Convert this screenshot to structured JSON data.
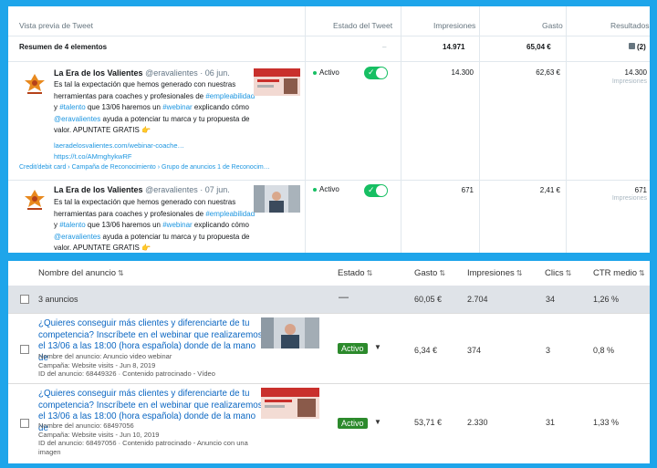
{
  "twitter": {
    "headers": {
      "preview": "Vista previa de Tweet",
      "status": "Estado del Tweet",
      "impressions": "Impresiones",
      "spend": "Gasto",
      "results": "Resultados"
    },
    "summary": {
      "label": "Resumen de 4 elementos",
      "status": "–",
      "impressions": "14.971",
      "spend": "65,04 €",
      "results": "(2)"
    },
    "rows": [
      {
        "name": "La Era de los Valientes",
        "handle": "@eravalientes · 06 jun.",
        "text_a": "Es tal la expectación que hemos generado con nuestras herramientas para coaches y profesionales de ",
        "tag1": "#empleabilidad",
        "text_b": " y ",
        "tag2": "#talento",
        "text_c": " que 13/06 haremos un ",
        "tag3": "#webinar",
        "text_d": " explicando cómo ",
        "mention": "@eravalientes",
        "text_e": " ayuda a potenciar tu marca y tu propuesta de valor. APUNTATE GRATIS 👉",
        "link1": "laeradelosvalientes.com/webinar-coache…",
        "link2": "https://t.co/AMmghykwRF",
        "breadcrumb": "Credit/debit card  ›  Campaña de Reconocimiento  ›  Grupo de anuncios 1 de Reconocim…",
        "status": "Activo",
        "impressions": "14.300",
        "spend": "62,63 €",
        "results": "14.300",
        "results_label": "Impresiones"
      },
      {
        "name": "La Era de los Valientes",
        "handle": "@eravalientes · 07 jun.",
        "text_a": "Es tal la expectación que hemos generado con nuestras herramientas para coaches y profesionales de ",
        "tag1": "#empleabilidad",
        "text_b": " y ",
        "tag2": "#talento",
        "text_c": " que 13/06 haremos un ",
        "tag3": "#webinar",
        "text_d": " explicando cómo ",
        "mention": "@eravalientes",
        "text_e": " ayuda a potenciar tu marca y tu propuesta de valor. APUNTATE GRATIS 👉",
        "status": "Activo",
        "impressions": "671",
        "spend": "2,41 €",
        "results": "671",
        "results_label": "Impresiones"
      }
    ]
  },
  "linkedin": {
    "headers": {
      "name": "Nombre del anuncio",
      "status": "Estado",
      "spend": "Gasto",
      "impressions": "Impresiones",
      "clicks": "Clics",
      "ctr": "CTR medio"
    },
    "sort_icon": "⇅",
    "summary": {
      "label": "3 anuncios",
      "status": "—",
      "spend": "60,05 €",
      "impressions": "2.704",
      "clicks": "34",
      "ctr": "1,26 %"
    },
    "rows": [
      {
        "title": "¿Quieres conseguir más clientes y diferenciarte de tu competencia? Inscríbete en el webinar que realizaremos el 13/06 a las 18:00 (hora española) donde de la mano de",
        "meta1": "Nombre del anuncio: Anuncio video webinar",
        "meta2": "Campaña: Website visits - Jun 8, 2019",
        "meta3": "ID del anuncio: 68449326 · Contenido patrocinado - Vídeo",
        "status": "Activo",
        "spend": "6,34 €",
        "impressions": "374",
        "clicks": "3",
        "ctr": "0,8 %"
      },
      {
        "title": "¿Quieres conseguir más clientes y diferenciarte de tu competencia? Inscríbete en el webinar que realizaremos el 13/06 a las 18:00 (hora española) donde de la mano de",
        "meta1": "Nombre del anuncio: 68497056",
        "meta2": "Campaña: Website visits - Jun 10, 2019",
        "meta3": "ID del anuncio: 68497056 · Contenido patrocinado - Anuncio con una imagen",
        "status": "Activo",
        "spend": "53,71 €",
        "impressions": "2.330",
        "clicks": "31",
        "ctr": "1,33 %"
      }
    ]
  },
  "colors": {
    "frame": "#1ea5ea",
    "twitter_link": "#1b95e0",
    "toggle_on": "#17bf63",
    "linkedin_link": "#0a66c2",
    "linkedin_active": "#2c8a2c",
    "summary_bg": "#dfe3e8"
  }
}
